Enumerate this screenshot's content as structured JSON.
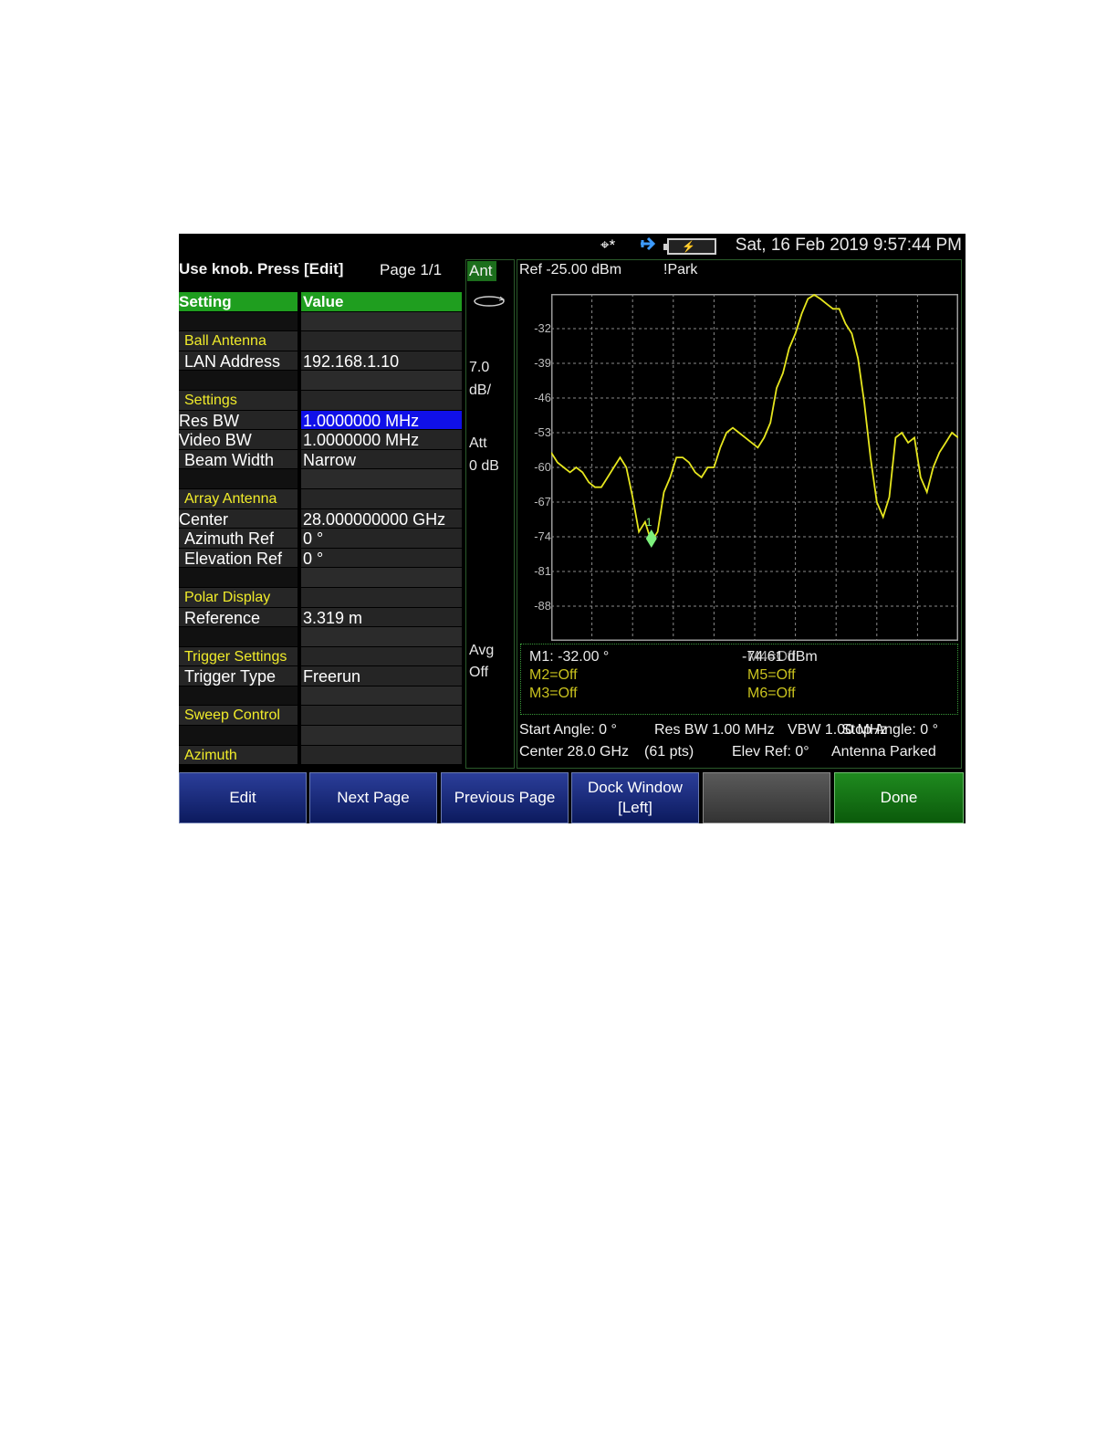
{
  "status_bar": {
    "datetime": "Sat, 16 Feb 2019 9:57:44 PM",
    "gps_symbol": "⌖*",
    "gps_icon": "gps-icon",
    "usb_icon": "usb-icon",
    "battery_icon": "battery-icon"
  },
  "header": {
    "hint": "Use knob. Press [Edit]",
    "page": "Page 1/1"
  },
  "table": {
    "col_setting": "Setting",
    "col_value": "Value",
    "rows": [
      {
        "type": "blank",
        "setting": "",
        "value": ""
      },
      {
        "type": "section",
        "setting": "Ball Antenna",
        "value": ""
      },
      {
        "type": "plain",
        "setting": "LAN Address",
        "value": "192.168.1.10"
      },
      {
        "type": "blank",
        "setting": "",
        "value": ""
      },
      {
        "type": "section",
        "setting": "Settings",
        "value": ""
      },
      {
        "type": "plain",
        "setting": "Res BW",
        "value": "1.0000000 MHz",
        "selected": true
      },
      {
        "type": "plain",
        "setting": "Video BW",
        "value": "1.0000000 MHz"
      },
      {
        "type": "plain",
        "setting": "Beam Width",
        "value": "Narrow"
      },
      {
        "type": "blank",
        "setting": "",
        "value": ""
      },
      {
        "type": "section",
        "setting": "Array Antenna",
        "value": ""
      },
      {
        "type": "plain",
        "setting": "Center",
        "value": "28.000000000 GHz"
      },
      {
        "type": "plain",
        "setting": "Azimuth Ref",
        "value": "0 °"
      },
      {
        "type": "plain",
        "setting": "Elevation Ref",
        "value": "0 °"
      },
      {
        "type": "blank",
        "setting": "",
        "value": ""
      },
      {
        "type": "section",
        "setting": "Polar Display",
        "value": ""
      },
      {
        "type": "plain",
        "setting": "Reference",
        "value": "3.319 m"
      },
      {
        "type": "blank",
        "setting": "",
        "value": ""
      },
      {
        "type": "section",
        "setting": "Trigger Settings",
        "value": ""
      },
      {
        "type": "plain",
        "setting": "Trigger Type",
        "value": "Freerun"
      },
      {
        "type": "blank",
        "setting": "",
        "value": ""
      },
      {
        "type": "section",
        "setting": "Sweep Control",
        "value": ""
      },
      {
        "type": "blank",
        "setting": "",
        "value": ""
      },
      {
        "type": "section",
        "setting": "Azimuth",
        "value": ""
      }
    ]
  },
  "strip": {
    "ant_label": "Ant",
    "scale_value": "7.0",
    "scale_unit": "dB/",
    "att_label": "Att",
    "att_value": "0 dB",
    "avg_label": "Avg",
    "avg_value": "Off"
  },
  "graph": {
    "ref_level": "Ref -25.00 dBm",
    "park_flag": "!Park",
    "y_ticks": [
      "-32",
      "-39",
      "-46",
      "-53",
      "-60",
      "-67",
      "-74",
      "-81",
      "-88"
    ],
    "trace_color": "#e6e61e",
    "marker_color": "#7cf07c",
    "marker_label": "1"
  },
  "chart_data": {
    "type": "line",
    "ylim": [
      -95,
      -25
    ],
    "xlim": [
      0,
      60
    ],
    "y_ticks": [
      -32,
      -39,
      -46,
      -53,
      -60,
      -67,
      -74,
      -81,
      -88
    ],
    "series": [
      {
        "values": [
          -57,
          -59,
          -60,
          -61,
          -60,
          -61,
          -63,
          -64,
          -64,
          -62,
          -60,
          -58,
          -60,
          -66,
          -73,
          -71,
          -75,
          -73,
          -65,
          -62,
          -58,
          -58,
          -59,
          -61,
          -62,
          -60,
          -60,
          -56,
          -53,
          -52,
          -53,
          -54,
          -55,
          -56,
          -54,
          -51,
          -44,
          -41,
          -36,
          -33,
          -29,
          -26,
          -25,
          -26,
          -27,
          -28,
          -28,
          -31,
          -33,
          -38,
          -47,
          -58,
          -67,
          -70,
          -66,
          -54,
          -53,
          -55,
          -54,
          -62,
          -65,
          -60,
          -57,
          -55,
          -53,
          -54
        ]
      }
    ],
    "marker": {
      "index": 16,
      "y": -74
    }
  },
  "markers": {
    "m1": "M1:  -32.00 °",
    "m1_value": "-74.61 dBm",
    "m2": "M2=Off",
    "m3": "M3=Off",
    "m4": "M4=Off",
    "m5": "M5=Off",
    "m6": "M6=Off"
  },
  "info": {
    "start_angle": "Start Angle: 0 °",
    "res_bw": "Res BW 1.00 MHz",
    "vbw": "VBW 1.00 MHz",
    "stop_angle": "Stop Angle: 0 °",
    "center": "Center 28.0 GHz",
    "pts": "(61 pts)",
    "elev_ref": "Elev Ref: 0°",
    "antenna_status": "Antenna Parked"
  },
  "softkeys": {
    "edit": "Edit",
    "next_page": "Next Page",
    "previous_page": "Previous Page",
    "dock_window_1": "Dock Window",
    "dock_window_2": "[Left]",
    "blank": "",
    "done": "Done"
  }
}
